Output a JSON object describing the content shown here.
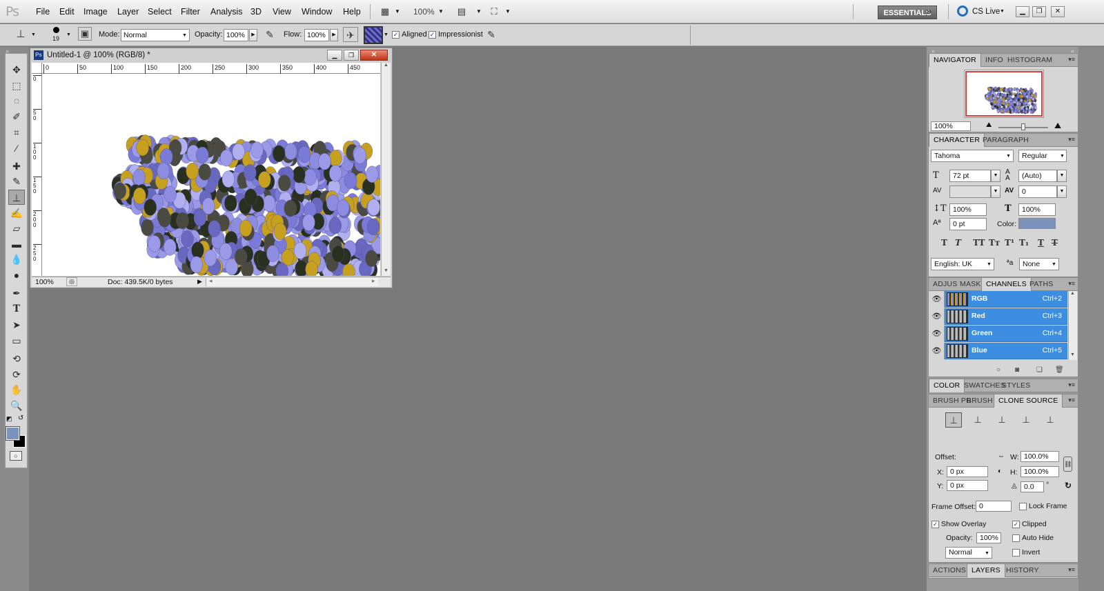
{
  "menubar": {
    "logo": "Ps",
    "items": [
      "File",
      "Edit",
      "Image",
      "Layer",
      "Select",
      "Filter",
      "Analysis",
      "3D",
      "View",
      "Window",
      "Help"
    ],
    "zoom": "100%",
    "workspace": "ESSENTIALS",
    "cs_live": "CS Live"
  },
  "options": {
    "brush_size": "19",
    "mode_label": "Mode:",
    "mode_value": "Normal",
    "opacity_label": "Opacity:",
    "opacity_value": "100%",
    "flow_label": "Flow:",
    "flow_value": "100%",
    "aligned": "Aligned",
    "impressionist": "Impressionist"
  },
  "document": {
    "title": "Untitled-1 @ 100% (RGB/8) *",
    "zoom": "100%",
    "doc_info": "Doc: 439.5K/0 bytes",
    "ruler_top": [
      "0",
      "50",
      "100",
      "150",
      "200",
      "250",
      "300",
      "350",
      "400",
      "450"
    ],
    "ruler_left": [
      "0",
      "5\n0",
      "1\n0\n0",
      "1\n5\n0",
      "2\n0\n0",
      "2\n5\n0"
    ]
  },
  "navigator": {
    "tabs": [
      "NAVIGATOR",
      "INFO",
      "HISTOGRAM"
    ],
    "zoom": "100%"
  },
  "character": {
    "tabs": [
      "CHARACTER",
      "PARAGRAPH"
    ],
    "font_family": "Tahoma",
    "font_style": "Regular",
    "size": "72 pt",
    "leading": "(Auto)",
    "kerning": "",
    "tracking": "0",
    "vscale": "100%",
    "hscale": "100%",
    "baseline": "0 pt",
    "color_label": "Color:",
    "language": "English: UK",
    "antialias": "None"
  },
  "channels": {
    "tabs": [
      "ADJUS",
      "MASKS",
      "CHANNELS",
      "PATHS"
    ],
    "rows": [
      {
        "name": "RGB",
        "key": "Ctrl+2"
      },
      {
        "name": "Red",
        "key": "Ctrl+3"
      },
      {
        "name": "Green",
        "key": "Ctrl+4"
      },
      {
        "name": "Blue",
        "key": "Ctrl+5"
      }
    ]
  },
  "color_panel": {
    "tabs": [
      "COLOR",
      "SWATCHES",
      "STYLES"
    ]
  },
  "clone_source": {
    "tabs": [
      "BRUSH PR",
      "BRUSH",
      "CLONE SOURCE"
    ],
    "offset_label": "Offset:",
    "w_label": "W:",
    "w_value": "100.0%",
    "h_label": "H:",
    "h_value": "100.0%",
    "x_label": "X:",
    "x_value": "0 px",
    "y_label": "Y:",
    "y_value": "0 px",
    "angle_value": "0.0",
    "angle_unit": "°",
    "frame_offset_label": "Frame Offset:",
    "frame_offset_value": "0",
    "lock_frame": "Lock Frame",
    "show_overlay": "Show Overlay",
    "clipped": "Clipped",
    "opacity_label": "Opacity:",
    "opacity_value": "100%",
    "auto_hide": "Auto Hide",
    "blend_mode": "Normal",
    "invert": "Invert"
  },
  "bottom_panel": {
    "tabs": [
      "ACTIONS",
      "LAYERS",
      "HISTORY"
    ]
  },
  "colors": {
    "foreground": "#7b93bd",
    "background": "#000000",
    "selection": "#3d8ee0",
    "paint_lavender": "#8c8ce0",
    "paint_gold": "#c8a020",
    "paint_dark": "#2a3020"
  }
}
